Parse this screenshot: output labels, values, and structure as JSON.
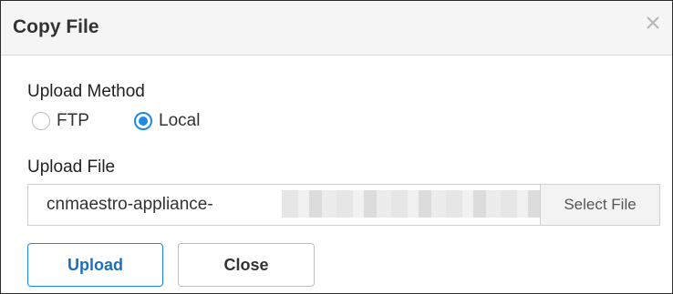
{
  "dialog": {
    "title": "Copy File",
    "close_icon": "close-icon"
  },
  "upload_method": {
    "label": "Upload Method",
    "options": [
      {
        "label": "FTP",
        "selected": false
      },
      {
        "label": "Local",
        "selected": true
      }
    ]
  },
  "upload_file": {
    "label": "Upload File",
    "value": "cnmaestro-appliance-",
    "select_label": "Select File"
  },
  "buttons": {
    "upload_label": "Upload",
    "close_label": "Close"
  },
  "colors": {
    "accent": "#1e88e5",
    "header_bg": "#f5f5f5"
  }
}
